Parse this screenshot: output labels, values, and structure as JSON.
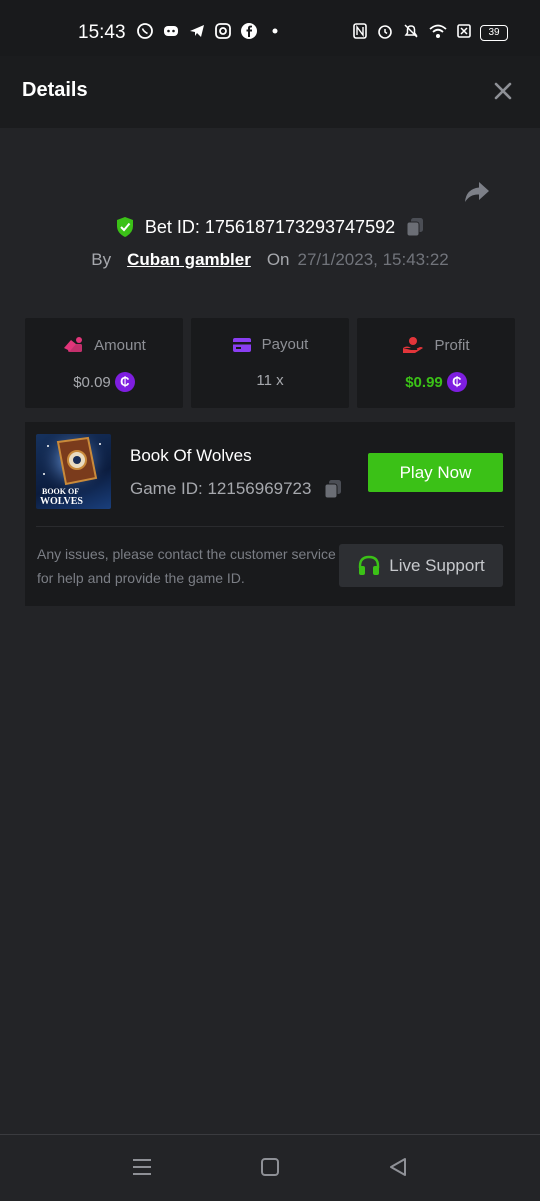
{
  "status_bar": {
    "time": "15:43",
    "battery": "39",
    "apps": [
      "whatsapp-icon",
      "discord-icon",
      "telegram-icon",
      "instagram-icon",
      "facebook-icon",
      "dot-icon"
    ],
    "indicators": [
      "nfc-icon",
      "alarm-icon",
      "mute-icon",
      "wifi-icon",
      "sim-icon"
    ]
  },
  "header": {
    "title": "Details"
  },
  "bet": {
    "id_label": "Bet ID: 1756187173293747592",
    "by_label": "By",
    "user": "Cuban gambler",
    "on_label": "On",
    "date": "27/1/2023, 15:43:22"
  },
  "stats": [
    {
      "label": "Amount",
      "value": "$0.09",
      "icon_color": "#e2357a",
      "coin": "₵"
    },
    {
      "label": "Payout",
      "value": "11 x",
      "icon_color": "#8a3ef2"
    },
    {
      "label": "Profit",
      "value": "$0.99",
      "icon_color": "#e2353a",
      "value_color": "#3bc117",
      "coin": "₵"
    }
  ],
  "game": {
    "name": "Book Of Wolves",
    "id_label": "Game ID: 12156969723",
    "play_label": "Play Now",
    "thumb_text": "BOOK OF WOLVES"
  },
  "support": {
    "help_text": "Any issues, please contact the customer service for help and provide the game ID.",
    "button_label": "Live Support"
  },
  "colors": {
    "accent_green": "#3bc117",
    "background": "#232427",
    "panel": "#191a1c"
  }
}
